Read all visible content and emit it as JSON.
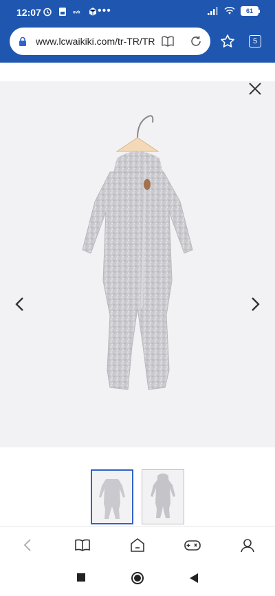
{
  "status_bar": {
    "time": "12:07",
    "battery": "61",
    "icons": [
      "alarm-icon",
      "sim-icon",
      "ovk-icon",
      "box-icon"
    ]
  },
  "browser": {
    "url": "www.lcwaikiki.com/tr-TR/TR",
    "tab_count": "5"
  },
  "product_viewer": {
    "thumbnails": [
      "thumbnail-front",
      "thumbnail-back"
    ],
    "selected_thumbnail": 0
  },
  "bottom_nav": [
    "back",
    "bookmarks",
    "home",
    "games",
    "profile"
  ],
  "colors": {
    "header": "#1f57b0",
    "thumbnail_selected": "#2f63c9"
  }
}
